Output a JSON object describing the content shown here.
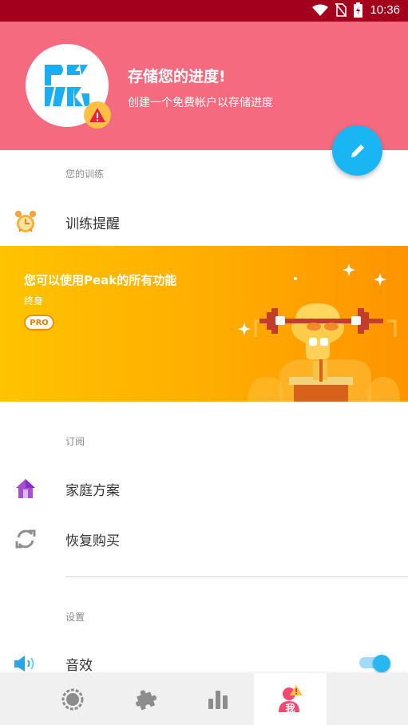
{
  "status_bar": {
    "time": "10:36",
    "icons": [
      "wifi-icon",
      "no-sim-icon",
      "battery-icon"
    ]
  },
  "header": {
    "title": "存储您的进度!",
    "subtitle": "创建一个免费帐户以存储进度",
    "avatar_icon": "peak-logo",
    "badge_icon": "warning-icon",
    "fab_icon": "edit-icon"
  },
  "sections": {
    "training_label": "您的训练",
    "subscription_label": "订阅",
    "settings_label": "设置"
  },
  "training_items": [
    {
      "label": "训练提醒",
      "icon": "alarm-clock-icon"
    }
  ],
  "promo": {
    "title": "您可以使用Peak的所有功能",
    "subtitle": "终身",
    "badge": "PRO"
  },
  "subscription_items": [
    {
      "label": "家庭方案",
      "icon": "house-icon"
    },
    {
      "label": "恢复购买",
      "icon": "refresh-icon"
    }
  ],
  "settings_items": [
    {
      "label": "音效",
      "icon": "speaker-icon",
      "toggle_on": true
    }
  ],
  "bottom_nav": {
    "items": [
      {
        "icon": "workout-icon",
        "active": false
      },
      {
        "icon": "puzzle-icon",
        "active": false
      },
      {
        "icon": "stats-icon",
        "active": false
      },
      {
        "icon": "profile-icon",
        "label": "我",
        "active": true
      }
    ]
  },
  "colors": {
    "status_bar": "#a3001c",
    "header": "#f46a7e",
    "fab": "#1ab6f4",
    "promo_start": "#ffc300",
    "promo_end": "#ff9400",
    "toggle": "#27b8f2",
    "profile_active": "#f04a72"
  }
}
